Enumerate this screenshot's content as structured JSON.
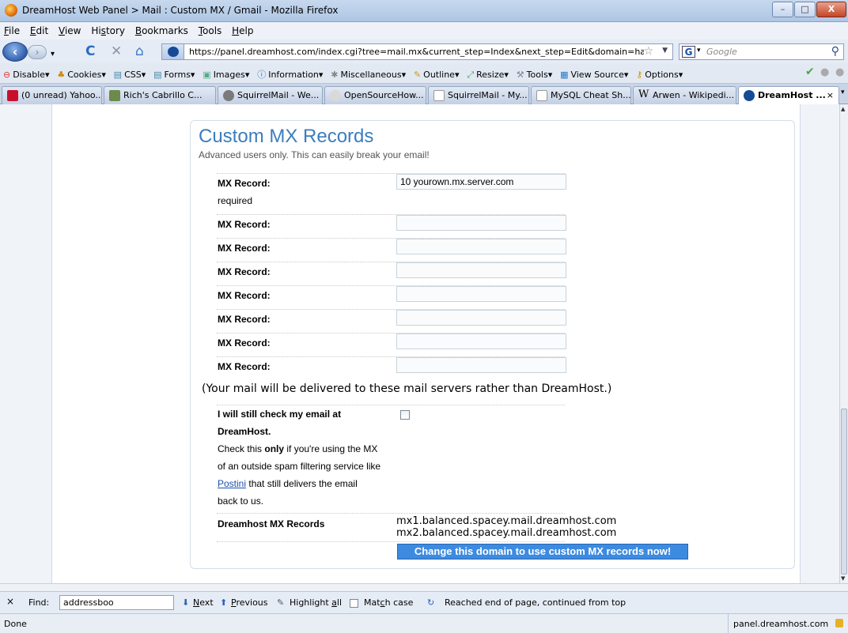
{
  "window": {
    "title": "DreamHost Web Panel > Mail : Custom MX / Gmail - Mozilla Firefox",
    "minimize": "–",
    "maximize": "□",
    "close": "X"
  },
  "menu": {
    "items": [
      {
        "u": "F",
        "rest": "ile"
      },
      {
        "u": "E",
        "rest": "dit"
      },
      {
        "u": "V",
        "rest": "iew"
      },
      {
        "pre": "Hi",
        "u": "s",
        "rest": "tory"
      },
      {
        "u": "B",
        "rest": "ookmarks"
      },
      {
        "u": "T",
        "rest": "ools"
      },
      {
        "u": "H",
        "rest": "elp"
      }
    ]
  },
  "nav": {
    "back": "‹",
    "forward": "›",
    "reload": "C",
    "stop": "✕",
    "home": "⌂",
    "url": "https://panel.dreamhost.com/index.cgi?tree=mail.mx&current_step=Index&next_step=Edit&domain=hayroc",
    "search_placeholder": "Google",
    "search_engine": "G"
  },
  "toolbar": {
    "items": [
      "Disable▾",
      "Cookies▾",
      "CSS▾",
      "Forms▾",
      "Images▾",
      "Information▾",
      "Miscellaneous▾",
      "Outline▾",
      "Resize▾",
      "Tools▾",
      "View Source▾",
      "Options▾"
    ]
  },
  "tabs": [
    {
      "label": "(0 unread) Yahoo...",
      "color": "#c8102e"
    },
    {
      "label": "Rich's Cabrillo C...",
      "color": "#6b8a4c"
    },
    {
      "label": "SquirrelMail - We...",
      "color": "#7a7a7a"
    },
    {
      "label": "OpenSourceHow...",
      "color": "#d9d9d9"
    },
    {
      "label": "SquirrelMail - My...",
      "color": "#ffffff"
    },
    {
      "label": "MySQL Cheat Sh...",
      "color": "#ffffff"
    },
    {
      "label": "Arwen - Wikipedi...",
      "color": "#ffffff"
    },
    {
      "label": "DreamHost ...",
      "color": "#174a96",
      "active": true
    }
  ],
  "page": {
    "heading": "Custom MX Records",
    "subheading": "Advanced users only. This can easily break your email!",
    "mx_label": "MX Record:",
    "required": "required",
    "mx_values": [
      "10 yourown.mx.server.com",
      "",
      "",
      "",
      "",
      "",
      "",
      ""
    ],
    "note": "(Your mail will be delivered to these mail servers rather than DreamHost.)",
    "check_title_1": "I will still check my email at",
    "check_title_2": "DreamHost.",
    "check_desc_1": "Check this ",
    "check_desc_only": "only",
    "check_desc_2": " if you're using the MX",
    "check_desc_3": "of an outside spam filtering service like",
    "check_link": "Postini",
    "check_desc_4": " that still delivers the email",
    "check_desc_5": "back to us.",
    "dh_label": "Dreamhost MX Records",
    "dh_records": [
      "mx1.balanced.spacey.mail.dreamhost.com",
      "mx2.balanced.spacey.mail.dreamhost.com"
    ],
    "submit": "Change this domain to use custom MX records now!"
  },
  "find": {
    "close": "×",
    "label": "Find:",
    "value": "addressboo",
    "next_u": "N",
    "next_rest": "ext",
    "prev_u": "P",
    "prev_rest": "revious",
    "highlight_pre": "Highlight ",
    "highlight_u": "a",
    "highlight_rest": "ll",
    "match_pre": "Mat",
    "match_u": "c",
    "match_rest": "h case",
    "status": "Reached end of page, continued from top"
  },
  "status": {
    "text": "Done",
    "host": "panel.dreamhost.com"
  }
}
